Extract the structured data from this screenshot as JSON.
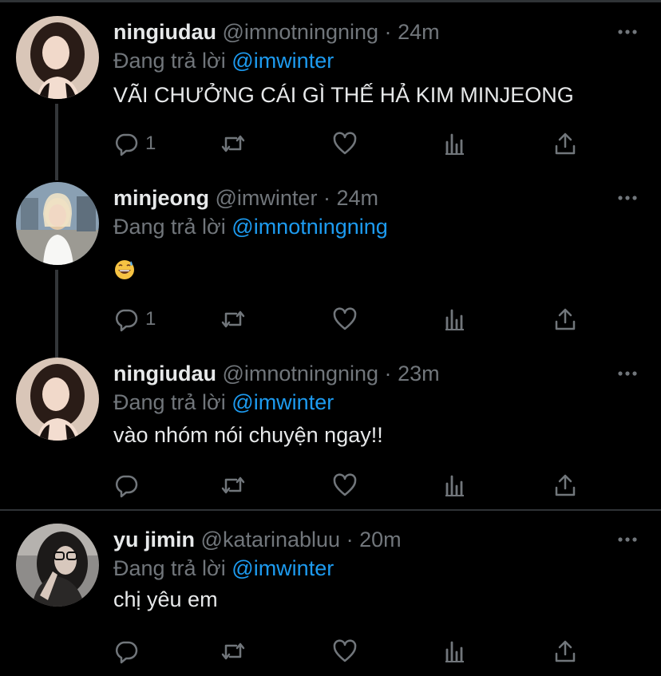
{
  "tweets": [
    {
      "name": "ningiudau",
      "handle": "@imnotningning",
      "dot": "·",
      "time": "24m",
      "reply_prefix": "Đang trả lời",
      "reply_to": "@imwinter",
      "text": "VÃI CHƯỞNG CÁI GÌ THẾ HẢ KIM MINJEONG",
      "reply_count": "1"
    },
    {
      "name": "minjeong",
      "handle": "@imwinter",
      "dot": "·",
      "time": "24m",
      "reply_prefix": "Đang trả lời",
      "reply_to": "@imnotningning",
      "text": "",
      "emoji": "grinning-sweat-emoji",
      "reply_count": "1"
    },
    {
      "name": "ningiudau",
      "handle": "@imnotningning",
      "dot": "·",
      "time": "23m",
      "reply_prefix": "Đang trả lời",
      "reply_to": "@imwinter",
      "text": "vào nhóm nói chuyện ngay!!",
      "reply_count": ""
    },
    {
      "name": "yu jimin",
      "handle": "@katarinabluu",
      "dot": "·",
      "time": "20m",
      "reply_prefix": "Đang trả lời",
      "reply_to": "@imwinter",
      "text": "chị yêu em",
      "reply_count": ""
    }
  ],
  "colors": {
    "background": "#000000",
    "name": "#e7e9ea",
    "muted": "#71767b",
    "mention": "#1d9bf0",
    "thread_line": "#333639"
  }
}
